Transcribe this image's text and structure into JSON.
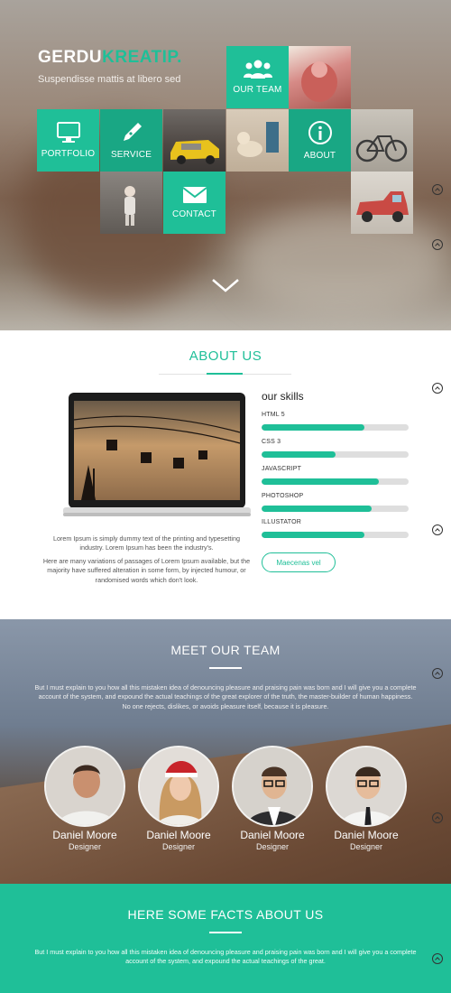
{
  "hero": {
    "brand_first": "GERDU",
    "brand_second": "KREATIP.",
    "tagline": "Suspendisse mattis at libero sed",
    "tiles": {
      "team": "OUR TEAM",
      "portfolio": "PORTFOLIO",
      "service": "SERVICE",
      "about": "ABOUT",
      "contact": "CONTACT"
    },
    "colors": {
      "accent": "#1fbf98"
    }
  },
  "about": {
    "title": "ABOUT US",
    "paragraph_1": "Lorem Ipsum is simply dummy text of the printing and typesetting industry. Lorem Ipsum has been the industry's.",
    "paragraph_2": "Here are many variations of passages of Lorem Ipsum available, but the majority have suffered alteration in some form, by injected humour, or randomised words which don't look.",
    "skills_title": "our skills",
    "skills": [
      {
        "name": "HTML 5",
        "level": 0.7
      },
      {
        "name": "CSS 3",
        "level": 0.5
      },
      {
        "name": "JAVASCRIPT",
        "level": 0.8
      },
      {
        "name": "PHOTOSHOP",
        "level": 0.75
      },
      {
        "name": "ILLUSTATOR",
        "level": 0.7
      }
    ],
    "button_label": "Maecenas vel"
  },
  "team": {
    "title": "MEET OUR TEAM",
    "text": "But I must explain to you how all this mistaken idea of denouncing pleasure and praising pain was born and I will give you a complete account of the system, and expound the actual teachings of the great explorer of the truth, the master-builder of human happiness. No one rejects, dislikes, or avoids pleasure itself, because it is pleasure.",
    "members": [
      {
        "name": "Daniel Moore",
        "role": "Designer"
      },
      {
        "name": "Daniel Moore",
        "role": "Designer"
      },
      {
        "name": "Daniel Moore",
        "role": "Designer"
      },
      {
        "name": "Daniel Moore",
        "role": "Designer"
      }
    ]
  },
  "facts": {
    "title": "HERE SOME FACTS ABOUT US",
    "text": "But I must explain to you how all this mistaken idea of denouncing pleasure and praising pain was born and I will give you a complete account of the system, and expound the actual teachings of the great."
  }
}
